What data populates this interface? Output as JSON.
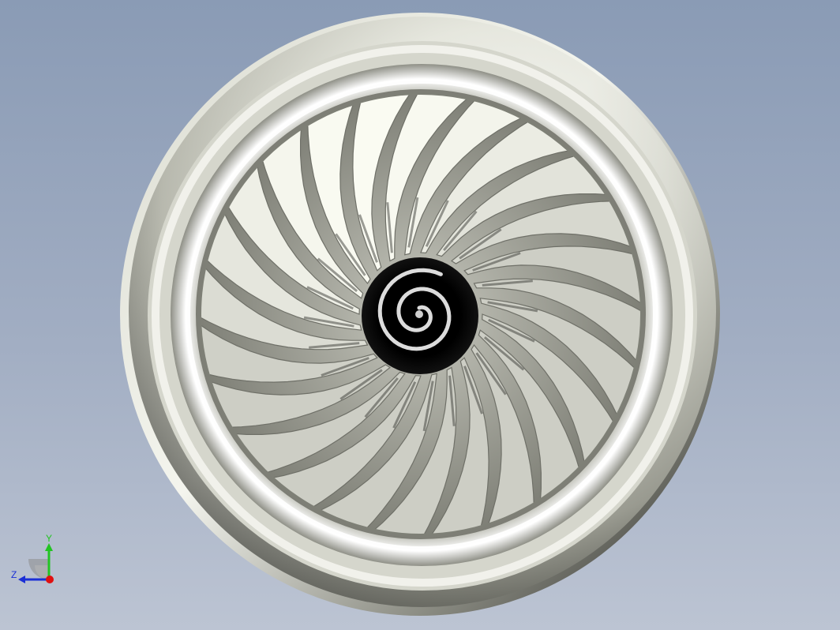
{
  "viewport": {
    "background_top": "#8a9bb5",
    "background_bottom": "#bcc4d3"
  },
  "model": {
    "object": "turbofan-engine-front-view",
    "fan_blade_count": 24,
    "spinner_color": "#000000",
    "spiral_color": "#dcdcdc",
    "nacelle_color": "#dfe0d6",
    "blade_color": "#e8e9df"
  },
  "triad": {
    "y_label": "Y",
    "z_label": "Z",
    "y_color": "#22c422",
    "z_color": "#1b2fd6",
    "x_color": "#e01010"
  }
}
